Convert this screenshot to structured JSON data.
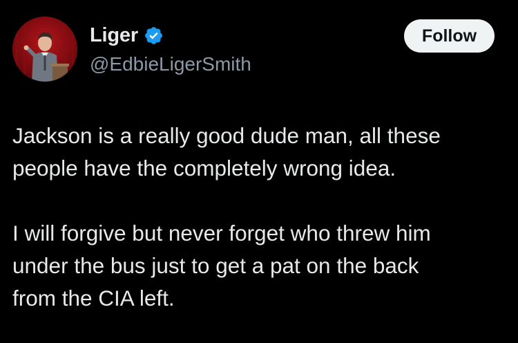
{
  "author": {
    "display_name": "Liger",
    "handle": "@EdbieLigerSmith",
    "verified": true,
    "avatar_icon": "profile-photo-speaker-at-podium",
    "verified_icon": "verified-badge-icon"
  },
  "actions": {
    "follow_label": "Follow"
  },
  "tweet": {
    "paragraphs": [
      "Jackson is a really good dude man, all these\npeople have the completely wrong idea.",
      "I will forgive but never forget who threw him\nunder the bus just to get a pat on the back\nfrom the CIA left."
    ]
  },
  "colors": {
    "background": "#000000",
    "text": "#e7e9ea",
    "secondary_text": "#8b98a5",
    "verified_blue": "#1d9bf0",
    "follow_button_bg": "#eff3f4",
    "follow_button_text": "#0f1419"
  }
}
